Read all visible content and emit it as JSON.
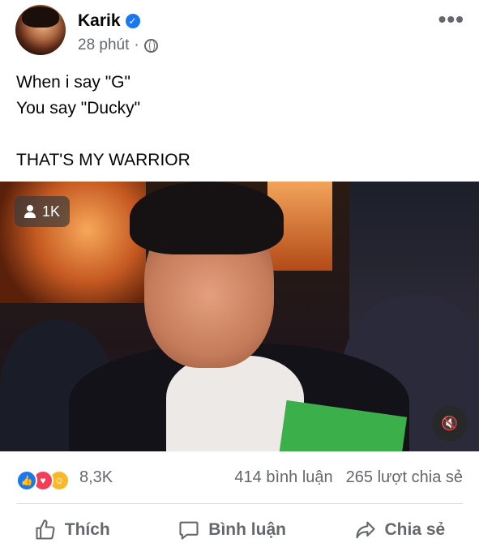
{
  "post": {
    "author": "Karik",
    "time": "28 phút",
    "separator": "·",
    "text": "When i say \"G\"\nYou say \"Ducky\"\n\nTHAT'S MY WARRIOR",
    "more_label": "•••"
  },
  "video": {
    "viewer_count": "1K"
  },
  "stats": {
    "reaction_count": "8,3K",
    "comments": "414 bình luận",
    "shares": "265 lượt chia sẻ"
  },
  "actions": {
    "like": "Thích",
    "comment": "Bình luận",
    "share": "Chia sẻ"
  },
  "icons": {
    "verified": "verified-badge-icon",
    "globe": "globe-icon",
    "viewer": "person-icon",
    "mute": "speaker-muted-icon"
  },
  "colors": {
    "accent": "#1877f2",
    "secondary_text": "#65676b"
  }
}
